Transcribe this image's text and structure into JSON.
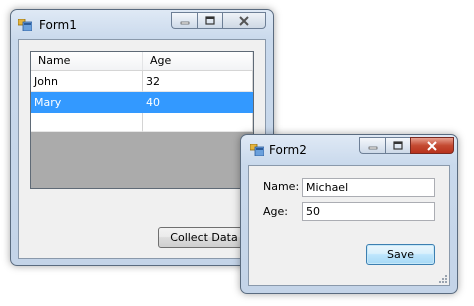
{
  "form1": {
    "title": "Form1",
    "list": {
      "columns": [
        "Name",
        "Age"
      ],
      "rows": [
        {
          "name": "John",
          "age": "32",
          "selected": false
        },
        {
          "name": "Mary",
          "age": "40",
          "selected": true
        },
        {
          "name": "",
          "age": "",
          "selected": false
        }
      ]
    },
    "collect_button": "Collect Data"
  },
  "form2": {
    "title": "Form2",
    "name_label": "Name:",
    "name_value": "Michael",
    "age_label": "Age:",
    "age_value": "50",
    "save_button": "Save"
  },
  "colors": {
    "selection": "#3399ff",
    "close_button_active": "#c44a32"
  },
  "icons": [
    "form-app-icon",
    "minimize-icon",
    "maximize-icon",
    "close-icon",
    "resize-grip-icon"
  ]
}
